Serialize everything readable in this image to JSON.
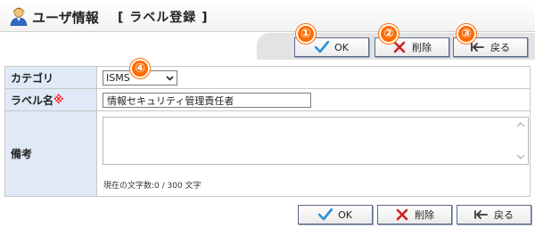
{
  "header": {
    "title": "ユーザ情報",
    "subtitle": "[ ラベル登録 ]"
  },
  "toolbar_top": {
    "ok_label": "OK",
    "delete_label": "削除",
    "back_label": "戻る"
  },
  "badges": [
    "①",
    "②",
    "③",
    "④"
  ],
  "form": {
    "category_label": "カテゴリ",
    "category_value": "ISMS",
    "label_name_label": "ラベル名",
    "required_mark": "※",
    "label_name_value": "情報セキュリティ管理責任者",
    "notes_label": "備考",
    "notes_value": "",
    "char_count": "現在の文字数:0 / 300 文字"
  },
  "toolbar_bottom": {
    "ok_label": "OK",
    "delete_label": "削除",
    "back_label": "戻る"
  },
  "colors": {
    "badge": "#ff6a00",
    "label_bg": "#dfe9f7",
    "ok_check": "#2a8fd8",
    "delete_x": "#d02020",
    "required": "#ff2a2a"
  }
}
